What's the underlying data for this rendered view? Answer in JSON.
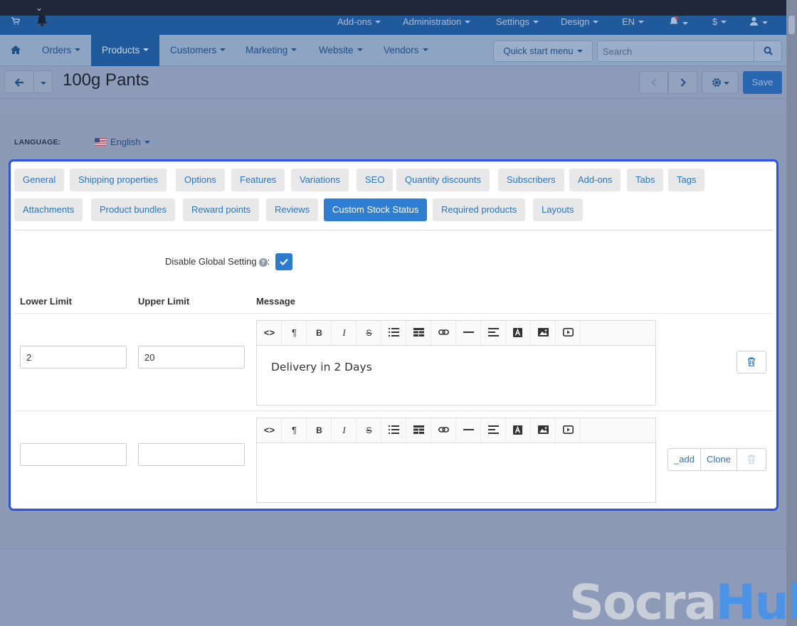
{
  "topbar": {
    "menus": [
      "Add-ons",
      "Administration",
      "Settings",
      "Design",
      "EN",
      "$"
    ]
  },
  "nav": {
    "items": [
      "Orders",
      "Products",
      "Customers",
      "Marketing",
      "Website",
      "Vendors"
    ],
    "active": "Products",
    "quick_start": "Quick start menu",
    "search_placeholder": "Search"
  },
  "header": {
    "title": "100g Pants",
    "save_label": "Save"
  },
  "language": {
    "label": "LANGUAGE:",
    "value": "English"
  },
  "tabs": {
    "row1": [
      "General",
      "Shipping properties",
      "Options",
      "Features",
      "Variations",
      "SEO",
      "Quantity discounts",
      "Subscribers",
      "Add-ons",
      "Tabs",
      "Tags"
    ],
    "row2": [
      "Attachments",
      "Product bundles",
      "Reward points",
      "Reviews",
      "Custom Stock Status",
      "Required products",
      "Layouts"
    ],
    "active": "Custom Stock Status"
  },
  "settings": {
    "disable_global_label": "Disable Global Setting",
    "disable_global_checked": true
  },
  "table": {
    "headers": {
      "lower": "Lower Limit",
      "upper": "Upper Limit",
      "message": "Message"
    },
    "rows": [
      {
        "lower": "2",
        "upper": "20",
        "message": "Delivery in 2 Days"
      },
      {
        "lower": "",
        "upper": "",
        "message": ""
      }
    ],
    "add_label": "_add",
    "clone_label": "Clone"
  },
  "watermark": {
    "part1": "Socra",
    "part2": "Hub"
  },
  "colors": {
    "highlight_border": "#2c51e6",
    "active_tab": "#2e7fd3",
    "link": "#2b74c0"
  }
}
